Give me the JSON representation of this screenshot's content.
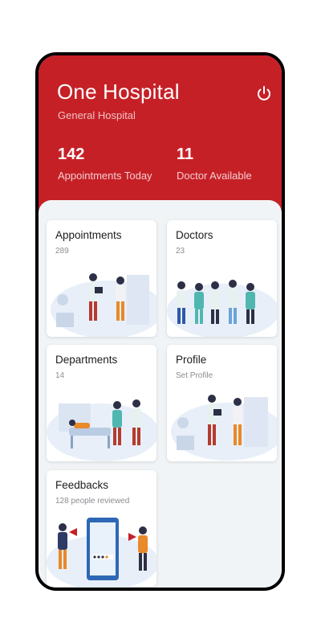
{
  "header": {
    "title": "One Hospital",
    "subtitle": "General Hospital",
    "stats": [
      {
        "value": "142",
        "label": "Appointments Today"
      },
      {
        "value": "11",
        "label": "Doctor Available"
      }
    ]
  },
  "icons": {
    "logout": "power-icon"
  },
  "colors": {
    "primary": "#c62027",
    "background": "#f1f4f6"
  },
  "cards": [
    {
      "title": "Appointments",
      "subtitle": "289",
      "image": "appointment-illustration"
    },
    {
      "title": "Doctors",
      "subtitle": "23",
      "image": "doctors-illustration"
    },
    {
      "title": "Departments",
      "subtitle": "14",
      "image": "department-illustration"
    },
    {
      "title": "Profile",
      "subtitle": "Set Profile",
      "image": "profile-illustration"
    },
    {
      "title": "Feedbacks",
      "subtitle": "128 people reviewed",
      "image": "feedback-illustration"
    }
  ]
}
